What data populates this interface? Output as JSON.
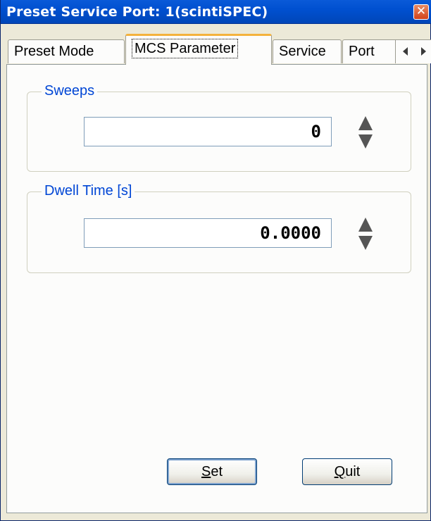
{
  "window": {
    "title": "Preset Service Port: 1(scintiSPEC)",
    "close_glyph": "✕"
  },
  "tabs": [
    {
      "label": "Preset Mode",
      "active": false
    },
    {
      "label": "MCS Parameter",
      "active": true
    },
    {
      "label": "Service",
      "active": false
    },
    {
      "label": "Port",
      "active": false
    }
  ],
  "tab_scroll": {
    "left_icon": "arrow-left-icon",
    "right_icon": "arrow-right-icon"
  },
  "sweeps": {
    "group_label": "Sweeps",
    "value": "0"
  },
  "dwell_time": {
    "group_label": "Dwell Time [s]",
    "value": "0.0000"
  },
  "buttons": {
    "set_mnemonic": "S",
    "set_rest": "et",
    "quit_mnemonic": "Q",
    "quit_rest": "uit"
  },
  "colors": {
    "titlebar": "#0050d0",
    "group_label": "#0046d5",
    "active_tab_accent": "#f4b23c",
    "close_button": "#d2421a"
  }
}
